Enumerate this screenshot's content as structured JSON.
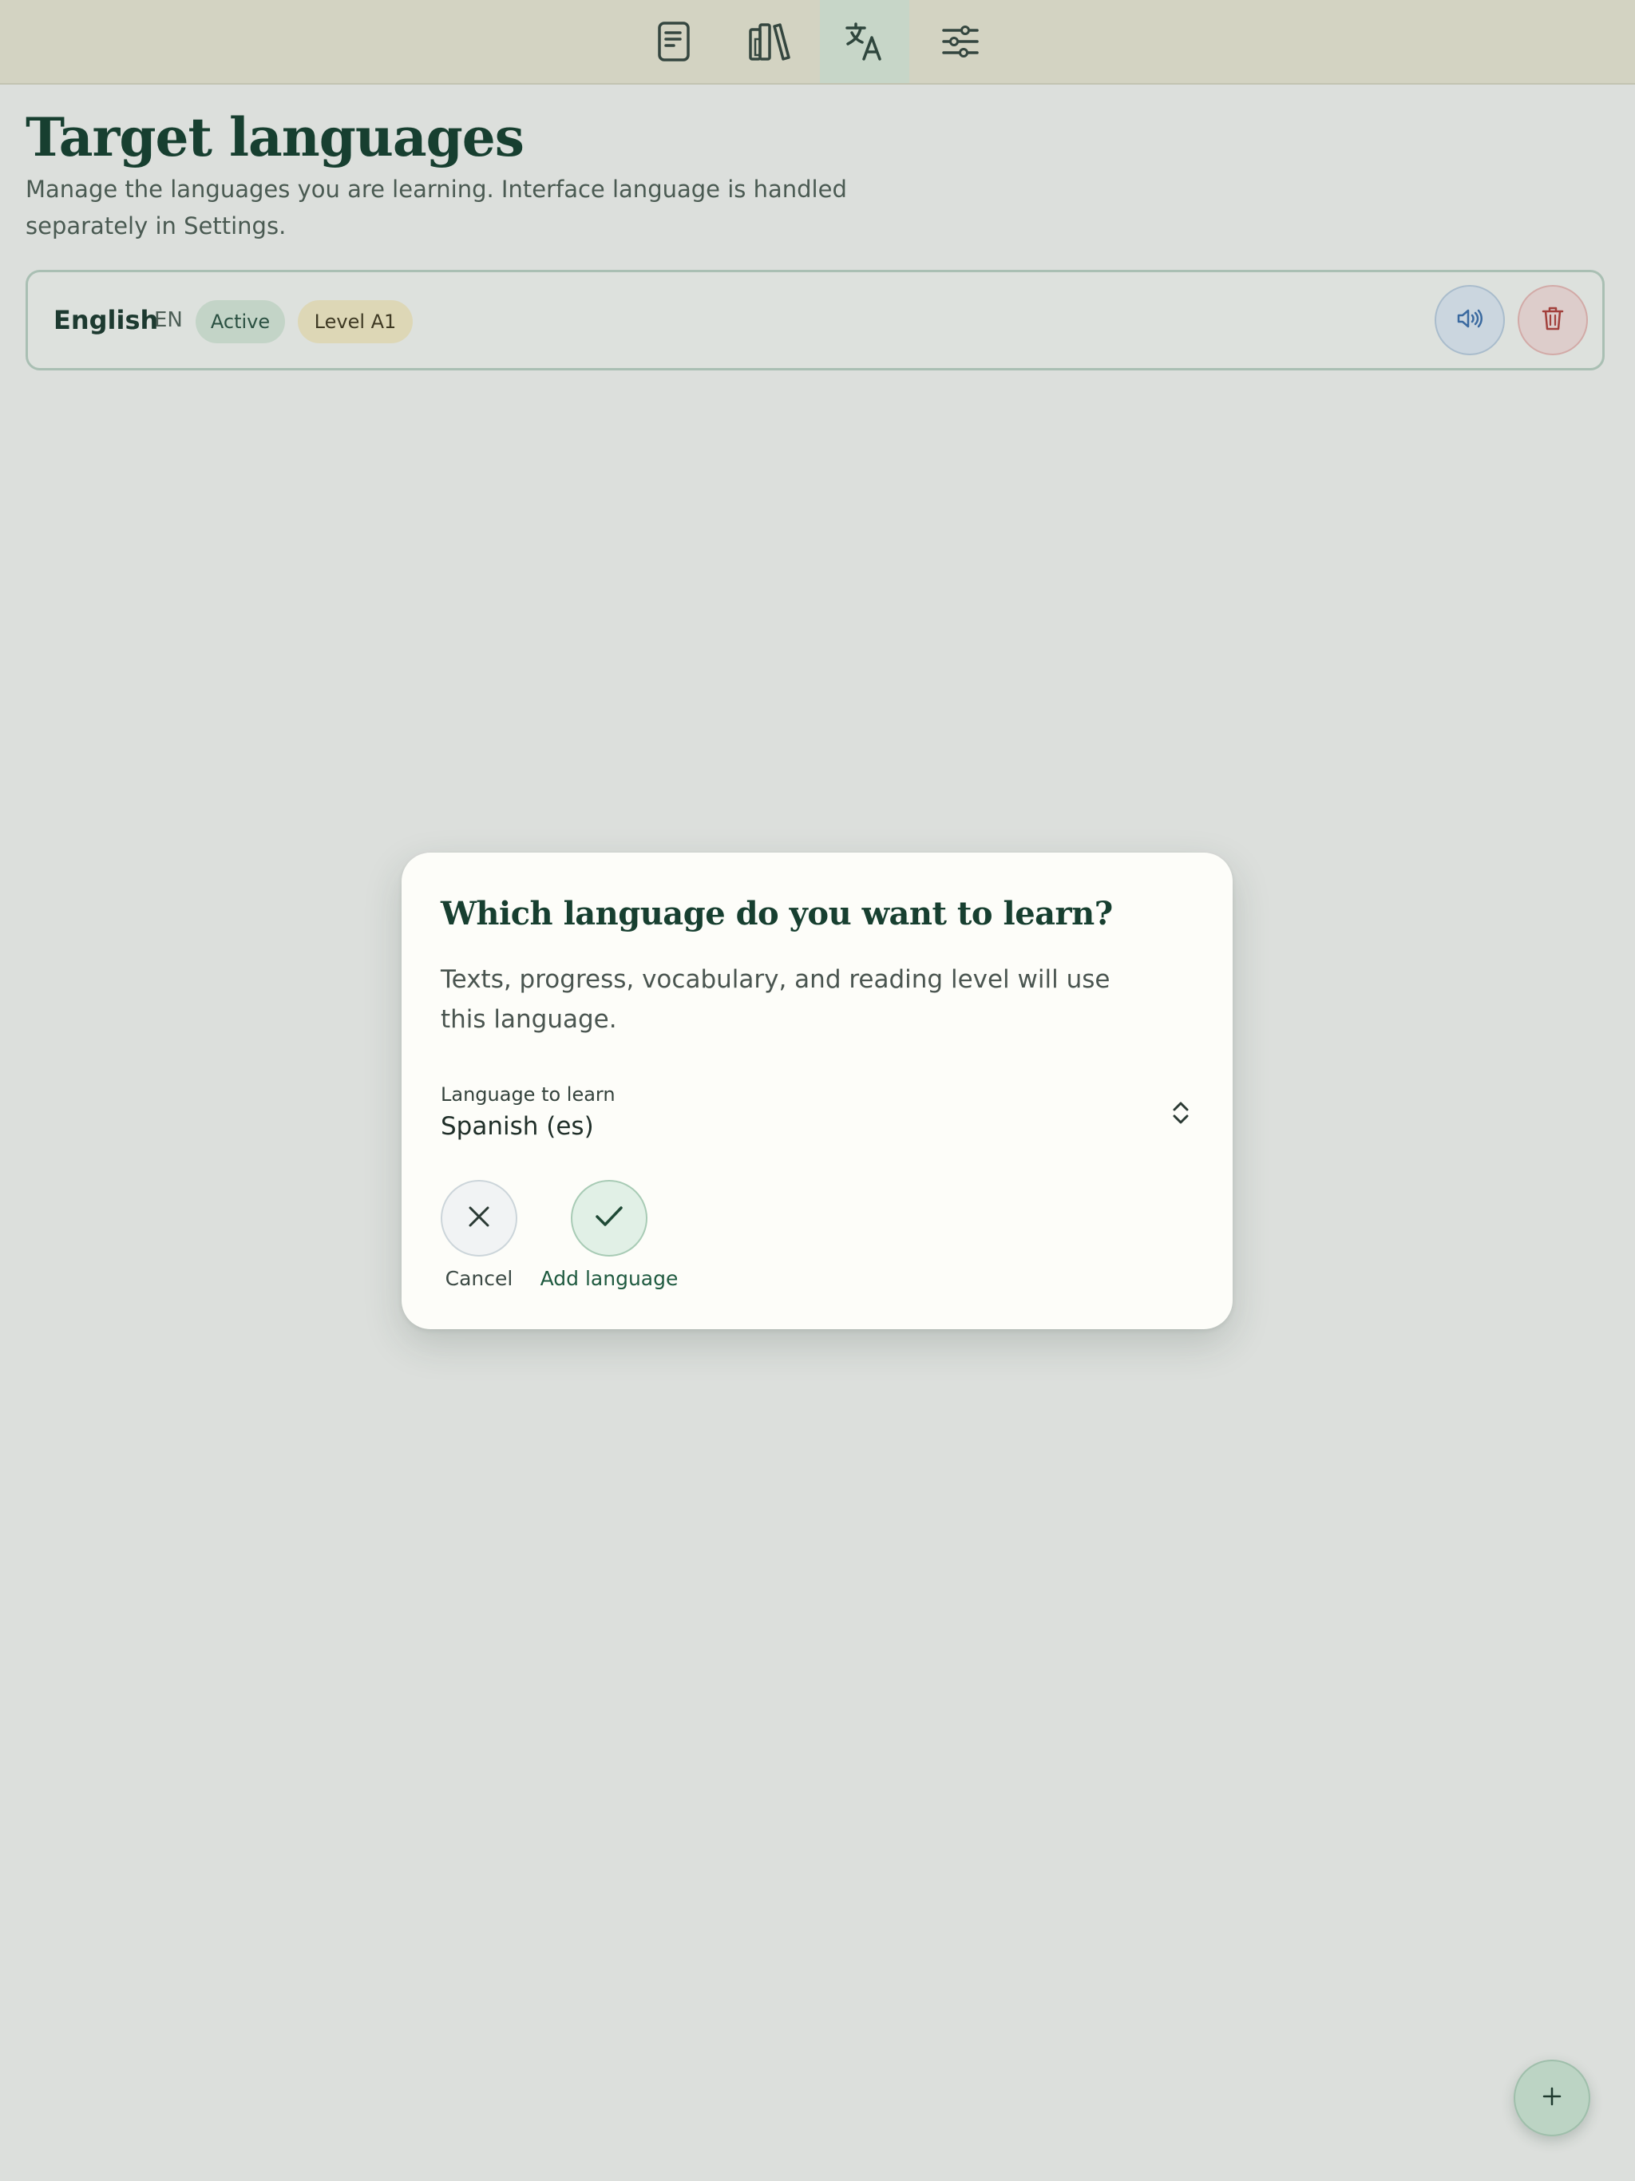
{
  "nav": {
    "items": [
      {
        "icon": "document-icon",
        "active": false
      },
      {
        "icon": "library-icon",
        "active": false
      },
      {
        "icon": "translate-icon",
        "active": true
      },
      {
        "icon": "sliders-icon",
        "active": false
      }
    ]
  },
  "page": {
    "title": "Target languages",
    "description": "Manage the languages you are learning. Interface language is handled separately in Settings."
  },
  "languages": [
    {
      "name": "English",
      "code": "EN",
      "status_badge": "Active",
      "level_badge": "Level A1",
      "actions": [
        "speaker-icon",
        "trash-icon"
      ]
    }
  ],
  "modal": {
    "title": "Which language do you want to learn?",
    "description": "Texts, progress, vocabulary, and reading level will use this language.",
    "select": {
      "label": "Language to learn",
      "value": "Spanish (es)"
    },
    "cancel_label": "Cancel",
    "add_label": "Add language"
  },
  "fab": {
    "icon": "plus-icon"
  },
  "colors": {
    "background": "#dcdfdc",
    "topbar": "#d3d3c2",
    "accent_dark": "#173f30",
    "active_badge": "#c3d4c7",
    "level_badge": "#ddd7b6",
    "speak_button": "#cbd6df",
    "delete_button": "#ddcdcb",
    "modal_surface": "#fdfdf9",
    "fab": "#bcd4c4"
  }
}
